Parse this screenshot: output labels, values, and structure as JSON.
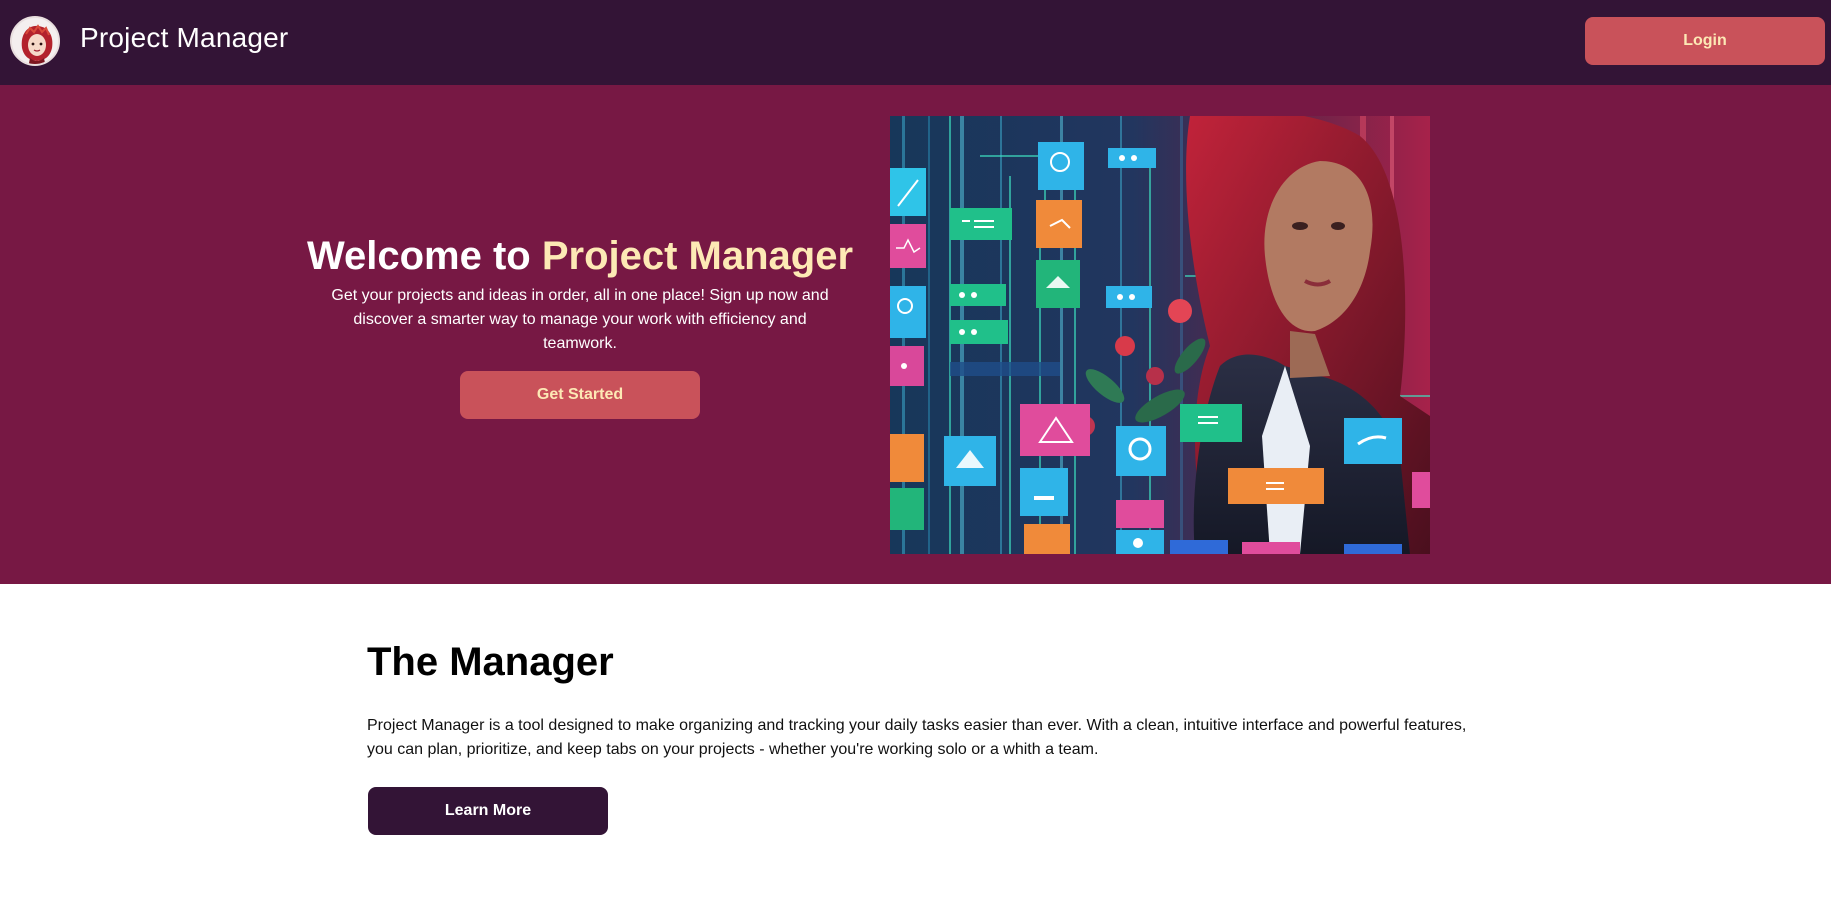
{
  "header": {
    "logo_icon": "avatar-logo-icon",
    "title": "Project Manager",
    "login_label": "Login"
  },
  "hero": {
    "title_prefix": "Welcome to ",
    "title_accent": "Project Manager",
    "subtitle": "Get your projects and ideas in order, all in one place! Sign up now and discover a smarter way to manage your work with efficiency and teamwork.",
    "cta_label": "Get Started",
    "image_icon": "hero-illustration-icon"
  },
  "about": {
    "title": "The Manager",
    "text": "Project Manager is a tool designed to make organizing and tracking your daily tasks easier than ever. With a clean, intuitive interface and powerful features, you can plan, prioritize, and keep tabs on your projects - whether you're working solo or a whith a team.",
    "cta_label": "Learn More"
  },
  "colors": {
    "header_bg": "#331436",
    "hero_bg": "#771844",
    "accent": "#fde9b5",
    "button": "#c9525a",
    "dark_button": "#331436"
  }
}
